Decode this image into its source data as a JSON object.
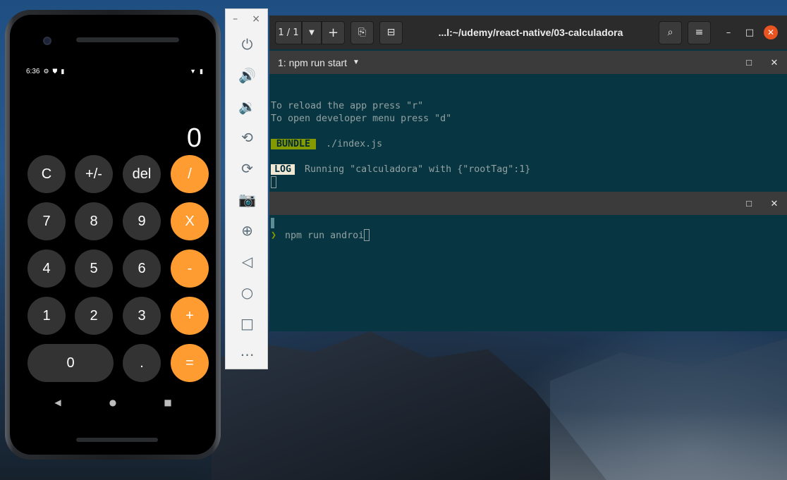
{
  "phone": {
    "status_time": "6:36",
    "status_left_icons": [
      "settings-icon",
      "shield-icon",
      "sim-icon"
    ],
    "status_right_icons": [
      "wifi-icon",
      "battery-icon"
    ],
    "display": "0",
    "keys": [
      {
        "label": "C",
        "type": "fn"
      },
      {
        "label": "+/-",
        "type": "fn"
      },
      {
        "label": "del",
        "type": "fn"
      },
      {
        "label": "/",
        "type": "op"
      },
      {
        "label": "7",
        "type": "num"
      },
      {
        "label": "8",
        "type": "num"
      },
      {
        "label": "9",
        "type": "num"
      },
      {
        "label": "X",
        "type": "op"
      },
      {
        "label": "4",
        "type": "num"
      },
      {
        "label": "5",
        "type": "num"
      },
      {
        "label": "6",
        "type": "num"
      },
      {
        "label": "-",
        "type": "op"
      },
      {
        "label": "1",
        "type": "num"
      },
      {
        "label": "2",
        "type": "num"
      },
      {
        "label": "3",
        "type": "num"
      },
      {
        "label": "+",
        "type": "op"
      },
      {
        "label": "0",
        "type": "num"
      },
      {
        "label": ".",
        "type": "num"
      },
      {
        "label": "=",
        "type": "op"
      }
    ],
    "nav": {
      "back": "◀",
      "home": "●",
      "recents": "■"
    }
  },
  "emulator": {
    "minimize": "–",
    "close": "×",
    "buttons": [
      {
        "name": "power-icon",
        "glyph": "⏻"
      },
      {
        "name": "volume-up-icon",
        "glyph": "🔊"
      },
      {
        "name": "volume-down-icon",
        "glyph": "🔉"
      },
      {
        "name": "rotate-left-icon",
        "glyph": "⟲"
      },
      {
        "name": "rotate-right-icon",
        "glyph": "⟳"
      },
      {
        "name": "camera-icon",
        "glyph": "📷"
      },
      {
        "name": "zoom-icon",
        "glyph": "⊕"
      },
      {
        "name": "back-icon",
        "glyph": "◁"
      },
      {
        "name": "home-icon",
        "glyph": "○"
      },
      {
        "name": "overview-icon",
        "glyph": "□"
      },
      {
        "name": "more-icon",
        "glyph": "⋯"
      }
    ]
  },
  "terminal": {
    "tab_counter": "1 / 1",
    "title": "...l:~/udemy/react-native/03-calculadora",
    "pane1": {
      "name": "1: npm run start",
      "lines": {
        "reload": "To reload the app press \"r\"",
        "devmenu": "To open developer menu press \"d\"",
        "bundle_tag": "BUNDLE",
        "bundle_file": "./index.js",
        "log_tag": "LOG",
        "log_text": "Running \"calculadora\" with {\"rootTag\":1}"
      }
    },
    "pane2": {
      "prompt": "❯",
      "command": "npm run androi"
    }
  },
  "colors": {
    "accent_orange": "#fe9c32",
    "key_gray": "#333333",
    "terminal_bg": "#073642",
    "bundle_green": "#859900",
    "ubuntu_close": "#e95420"
  }
}
